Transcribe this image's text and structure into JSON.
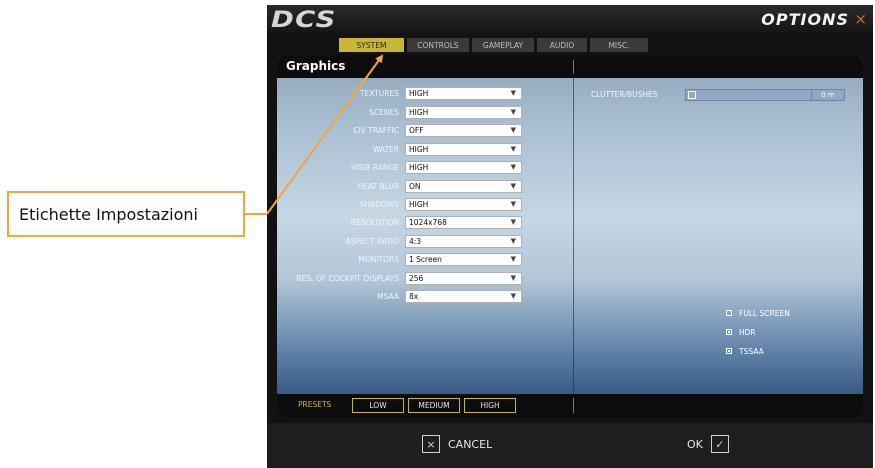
{
  "annotation": {
    "callout_text": "Etichette Impostazioni",
    "accent_color": "#f6a53a"
  },
  "window": {
    "logo": "DCS",
    "title": "OPTIONS",
    "close_glyph": "×"
  },
  "tabs": [
    {
      "label": "SYSTEM",
      "active": true
    },
    {
      "label": "CONTROLS",
      "active": false
    },
    {
      "label": "GAMEPLAY",
      "active": false
    },
    {
      "label": "AUDIO",
      "active": false
    },
    {
      "label": "MISC.",
      "active": false
    }
  ],
  "graphics": {
    "title": "Graphics",
    "settings": [
      {
        "label": "TEXTURES",
        "value": "HIGH"
      },
      {
        "label": "SCENES",
        "value": "HIGH"
      },
      {
        "label": "CIV TRAFFIC",
        "value": "OFF"
      },
      {
        "label": "WATER",
        "value": "HIGH"
      },
      {
        "label": "VISIB RANGE",
        "value": "HIGH"
      },
      {
        "label": "HEAT BLUR",
        "value": "ON"
      },
      {
        "label": "SHADOWS",
        "value": "HIGH"
      },
      {
        "label": "RESOLUTION",
        "value": "1024x768"
      },
      {
        "label": "ASPECT RATIO",
        "value": "4:3"
      },
      {
        "label": "MONITORS",
        "value": "1 Screen"
      },
      {
        "label": "RES. OF COCKPIT DISPLAYS",
        "value": "256"
      },
      {
        "label": "MSAA",
        "value": "8x"
      }
    ],
    "clutter": {
      "label": "CLUTTER/BUSHES",
      "value": "0 m"
    },
    "checkboxes": [
      {
        "label": "FULL SCREEN",
        "checked": false
      },
      {
        "label": "HDR",
        "checked": true
      },
      {
        "label": "TSSAA",
        "checked": true
      }
    ]
  },
  "presets": {
    "label": "PRESETS",
    "buttons": [
      "LOW",
      "MEDIUM",
      "HIGH"
    ]
  },
  "footer": {
    "cancel_label": "CANCEL",
    "cancel_glyph": "×",
    "ok_label": "OK",
    "ok_glyph": "✓"
  }
}
